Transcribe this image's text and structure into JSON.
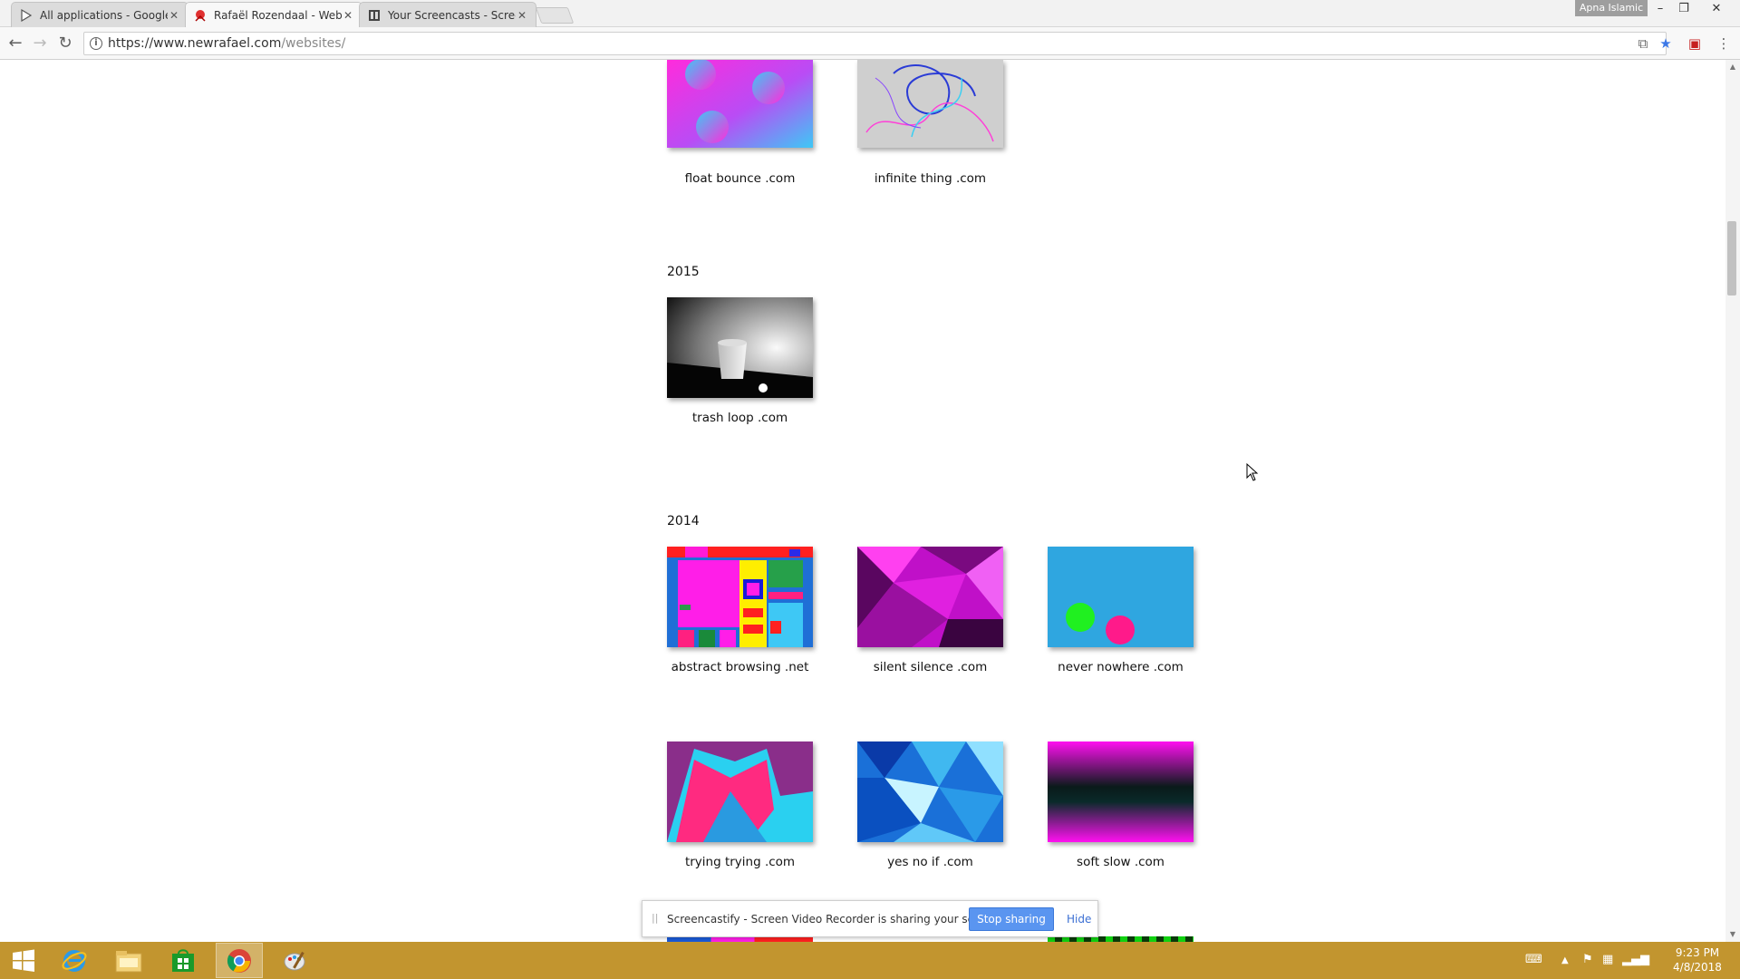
{
  "browser": {
    "tabs": [
      {
        "title": "All applications - Google",
        "icon": "google-play-icon"
      },
      {
        "title": "Rafaël Rozendaal - Webs",
        "icon": "site-favicon"
      },
      {
        "title": "Your Screencasts - Scree",
        "icon": "screencastify-icon"
      }
    ],
    "active_tab": 1,
    "profile_label": "Apna Islamic",
    "url_host": "https://www.newrafael.com",
    "url_path": "/websites/"
  },
  "page": {
    "sections": [
      {
        "year": "",
        "sites": [
          {
            "name": "float bounce .com"
          },
          {
            "name": "infinite thing .com"
          }
        ]
      },
      {
        "year": "2015",
        "sites": [
          {
            "name": "trash loop .com"
          }
        ]
      },
      {
        "year": "2014",
        "sites": [
          {
            "name": "abstract browsing .net"
          },
          {
            "name": "silent silence .com"
          },
          {
            "name": "never nowhere .com"
          },
          {
            "name": "trying trying .com"
          },
          {
            "name": "yes no if .com"
          },
          {
            "name": "soft slow .com"
          }
        ]
      }
    ]
  },
  "sharebar": {
    "message": "Screencastify - Screen Video Recorder is sharing your screen.",
    "stop_label": "Stop sharing",
    "hide_label": "Hide"
  },
  "taskbar": {
    "time": "9:23 PM",
    "date": "4/8/2018",
    "pinned": [
      "windows-start-icon",
      "internet-explorer-icon",
      "file-explorer-icon",
      "store-icon",
      "chrome-icon",
      "paint-icon"
    ]
  },
  "colors": {
    "taskbar": "#c2952f",
    "accent_button": "#5a95f0"
  }
}
